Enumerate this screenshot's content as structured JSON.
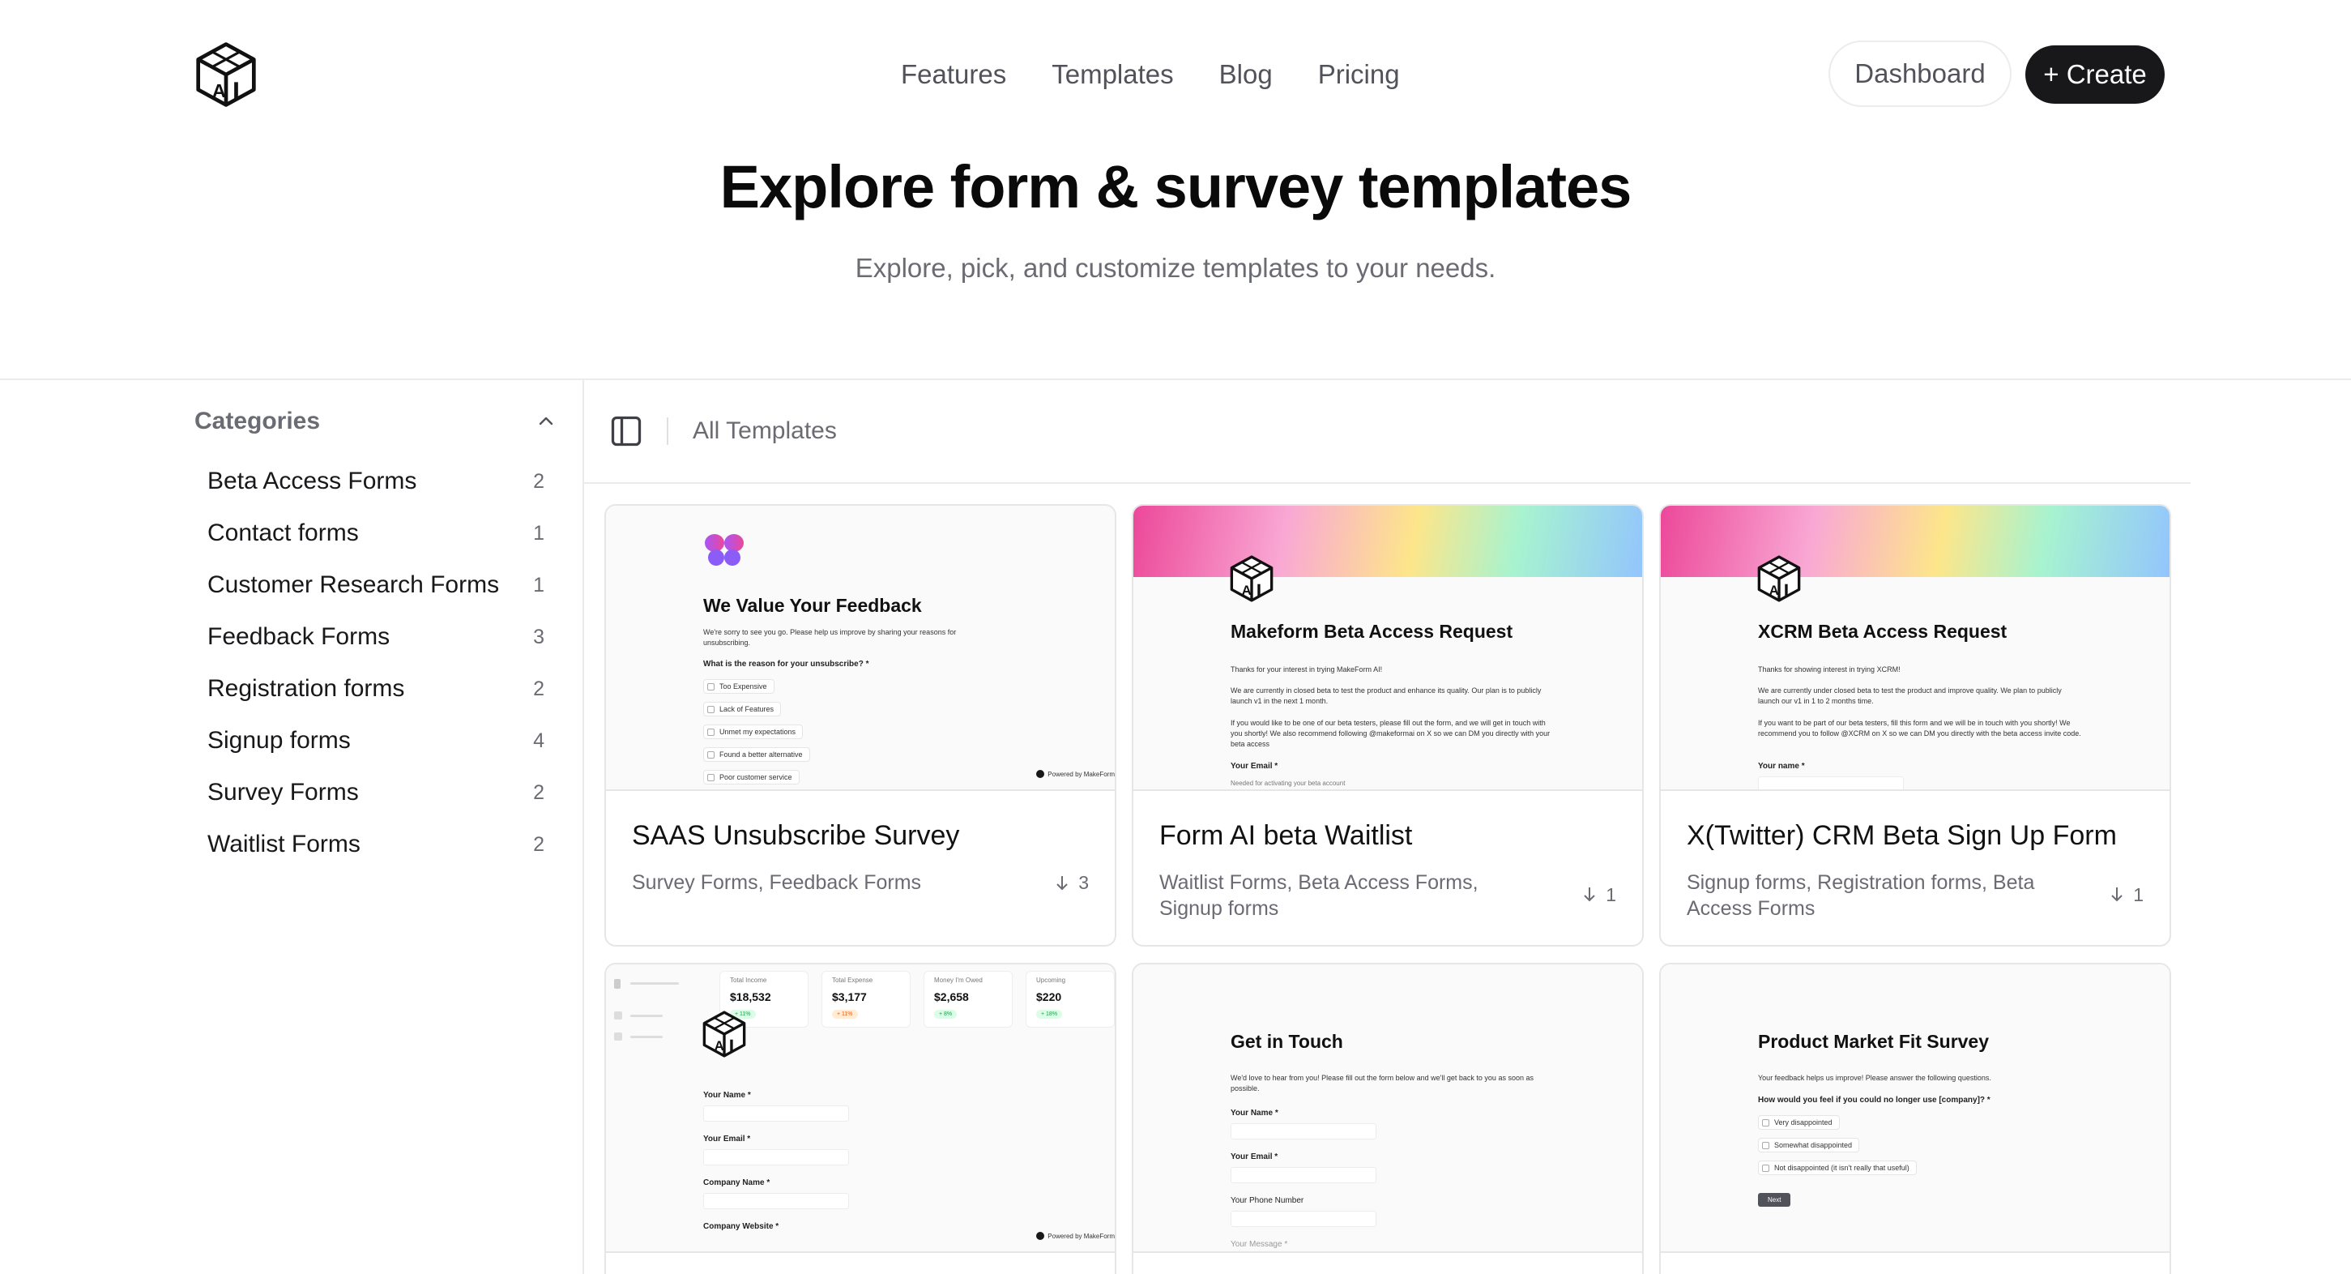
{
  "header": {
    "logo_text": "AI",
    "nav": [
      "Features",
      "Templates",
      "Blog",
      "Pricing"
    ],
    "dashboard_label": "Dashboard",
    "create_label": "+ Create"
  },
  "hero": {
    "title": "Explore form & survey templates",
    "subtitle": "Explore, pick, and customize templates to your needs."
  },
  "sidebar": {
    "heading": "Categories",
    "items": [
      {
        "label": "Beta Access Forms",
        "count": "2"
      },
      {
        "label": "Contact forms",
        "count": "1"
      },
      {
        "label": "Customer Research Forms",
        "count": "1"
      },
      {
        "label": "Feedback Forms",
        "count": "3"
      },
      {
        "label": "Registration forms",
        "count": "2"
      },
      {
        "label": "Signup forms",
        "count": "4"
      },
      {
        "label": "Survey Forms",
        "count": "2"
      },
      {
        "label": "Waitlist Forms",
        "count": "2"
      }
    ]
  },
  "toolbar": {
    "breadcrumb": "All Templates"
  },
  "cards": [
    {
      "title": "SAAS Unsubscribe Survey",
      "tags": "Survey Forms, Feedback Forms",
      "downloads": "3",
      "preview": {
        "heading": "We Value Your Feedback",
        "intro": "We're sorry to see you go. Please help us improve by sharing your reasons for unsubscribing.",
        "question": "What is the reason for your unsubscribe? *",
        "options": [
          "Too Expensive",
          "Lack of Features",
          "Unmet my expectations",
          "Found a better alternative",
          "Poor customer service"
        ],
        "powered": "Powered by MakeForm"
      }
    },
    {
      "title": "Form AI beta Waitlist",
      "tags": "Waitlist Forms, Beta Access Forms, Signup forms",
      "downloads": "1",
      "preview": {
        "heading": "Makeform Beta Access Request",
        "p1": "Thanks for your interest in trying MakeForm AI!",
        "p2": "We are currently in closed beta to test the product and enhance its quality. Our plan is to publicly launch v1 in the next 1 month.",
        "p3": "If you would like to be one of our beta testers, please fill out the form, and we will get in touch with you shortly! We also recommend following @makeformai on X so we can DM you directly with your beta access",
        "field_label": "Your Email *",
        "field_hint": "Needed for activating your beta account"
      }
    },
    {
      "title": "X(Twitter) CRM Beta Sign Up Form",
      "tags": "Signup forms, Registration forms, Beta Access Forms",
      "downloads": "1",
      "preview": {
        "heading": "XCRM Beta Access Request",
        "p1": "Thanks for showing interest in trying XCRM!",
        "p2": "We are currently under closed beta to test the product and improve quality. We plan to publicly launch our v1 in 1 to 2 months time.",
        "p3": "If you want to be part of our beta testers, fill this form and we will be in touch with you shortly! We recommend you to follow @XCRM on X so we can DM you directly with the beta access invite code.",
        "field_label": "Your name *"
      }
    },
    {
      "preview": {
        "stats": [
          {
            "label": "Total Income",
            "value": "$18,532",
            "chip": "+ 11%"
          },
          {
            "label": "Total Expense",
            "value": "$3,177",
            "chip": "+ 11%"
          },
          {
            "label": "Money I'm Owed",
            "value": "$2,658",
            "chip": "+ 8%"
          },
          {
            "label": "Upcoming",
            "value": "$220",
            "chip": "+ 18%"
          }
        ],
        "fields": [
          "Your Name *",
          "Your Email *",
          "Company Name *",
          "Company Website *"
        ],
        "powered": "Powered by MakeForm"
      }
    },
    {
      "preview": {
        "heading": "Get in Touch",
        "intro": "We'd love to hear from you! Please fill out the form below and we'll get back to you as soon as possible.",
        "fields": [
          "Your Name *",
          "Your Email *",
          "Your Phone Number",
          "Your Message *"
        ]
      }
    },
    {
      "preview": {
        "heading": "Product Market Fit Survey",
        "intro": "Your feedback helps us improve! Please answer the following questions.",
        "question": "How would you feel if you could no longer use [company]? *",
        "options": [
          "Very disappointed",
          "Somewhat disappointed",
          "Not disappointed (it isn't really that useful)"
        ],
        "next": "Next"
      }
    }
  ]
}
